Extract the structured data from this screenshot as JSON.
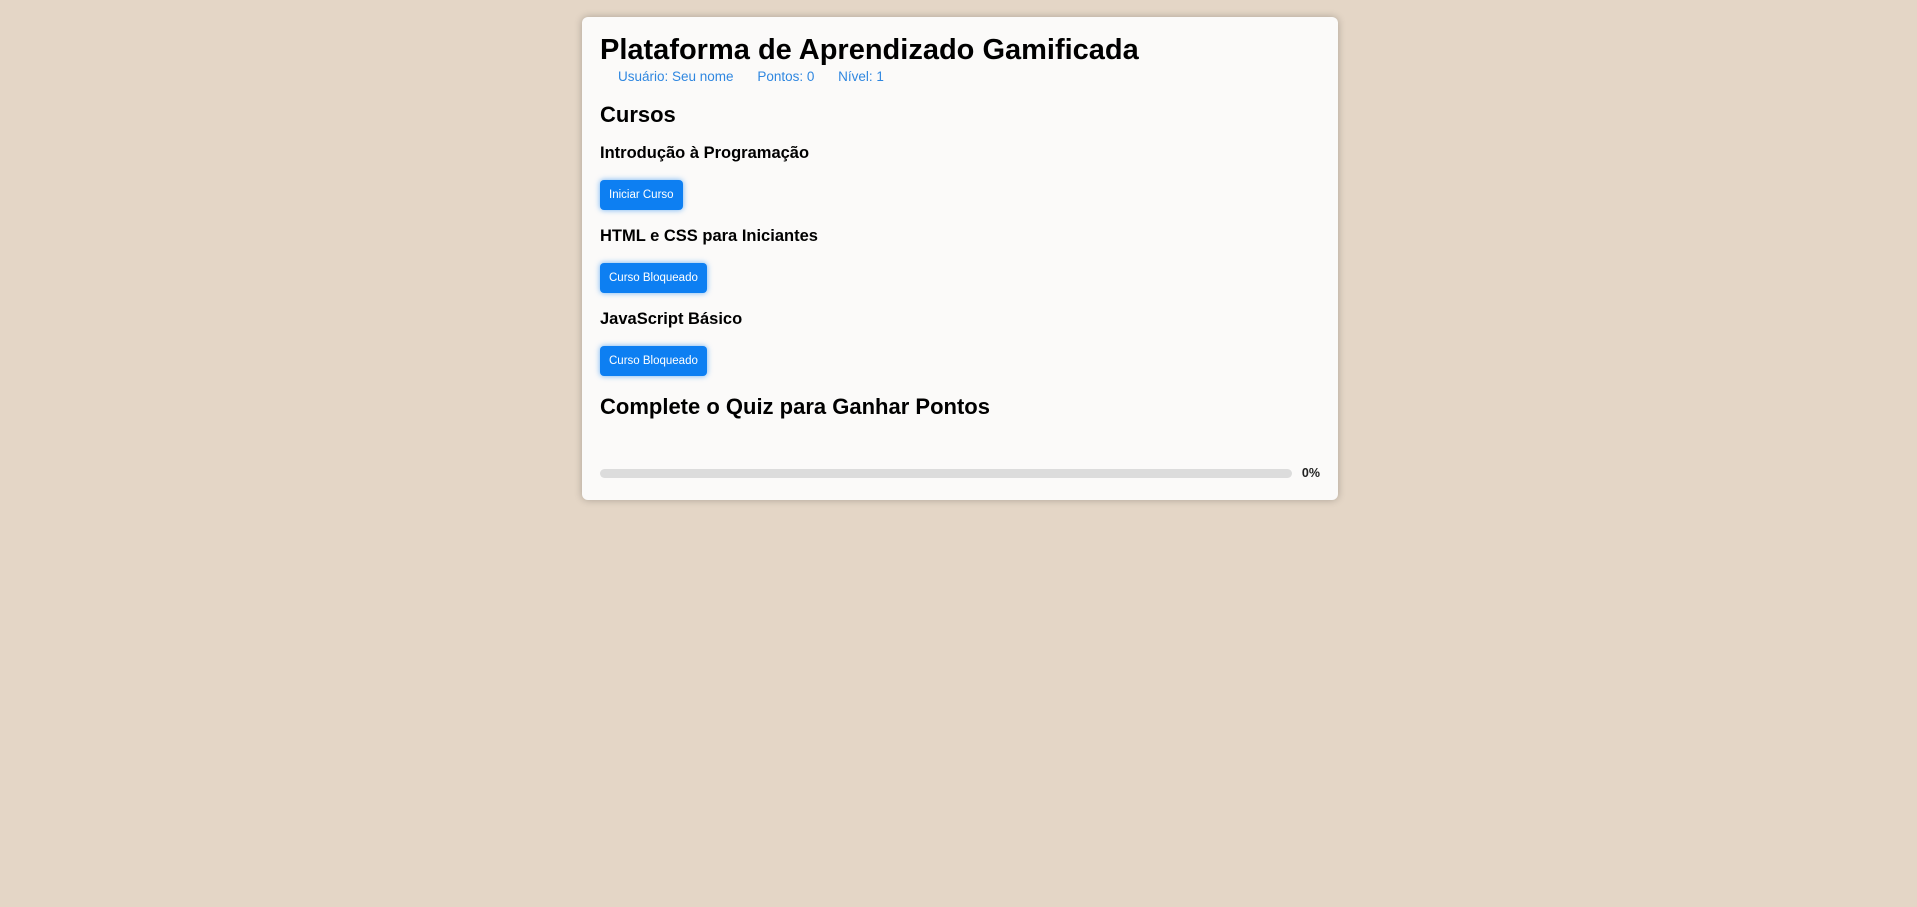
{
  "header": {
    "title": "Plataforma de Aprendizado Gamificada",
    "user": "Usuário: Seu nome",
    "points": "Pontos: 0",
    "level": "Nível: 1"
  },
  "courses": {
    "heading": "Cursos",
    "items": [
      {
        "title": "Introdução à Programação",
        "button": "Iniciar Curso"
      },
      {
        "title": "HTML e CSS para Iniciantes",
        "button": "Curso Bloqueado"
      },
      {
        "title": "JavaScript Básico",
        "button": "Curso Bloqueado"
      }
    ]
  },
  "quiz": {
    "heading": "Complete o Quiz para Ganhar Pontos",
    "progress_percent": 0,
    "progress_label": "0%"
  },
  "colors": {
    "background": "#e4d6c6",
    "accent": "#0d7ff2",
    "info_text": "#2f87e0"
  }
}
